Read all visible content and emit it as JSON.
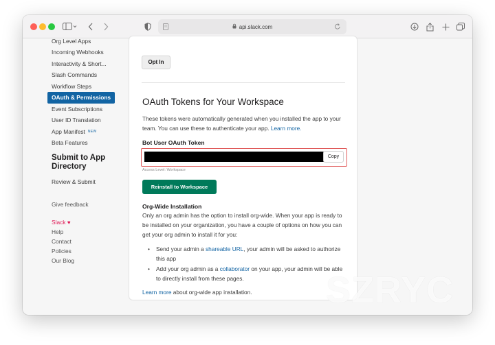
{
  "browser": {
    "url": "api.slack.com"
  },
  "sidebar": {
    "items": [
      {
        "label": "Org Level Apps"
      },
      {
        "label": "Incoming Webhooks"
      },
      {
        "label": "Interactivity & Short..."
      },
      {
        "label": "Slash Commands"
      },
      {
        "label": "Workflow Steps"
      },
      {
        "label": "OAuth & Permissions",
        "active": true
      },
      {
        "label": "Event Subscriptions"
      },
      {
        "label": "User ID Translation"
      },
      {
        "label": "App Manifest",
        "badge": "NEW"
      },
      {
        "label": "Beta Features"
      }
    ],
    "heading": "Submit to App Directory",
    "review": "Review & Submit",
    "feedback": "Give feedback",
    "footer": {
      "slack": "Slack",
      "heart": "♥",
      "help": "Help",
      "contact": "Contact",
      "policies": "Policies",
      "blog": "Our Blog"
    }
  },
  "main": {
    "optin_label": "Opt In",
    "title": "OAuth Tokens for Your Workspace",
    "desc": "These tokens were automatically generated when you installed the app to your team. You can use these to authenticate your app.",
    "desc_link": "Learn more.",
    "token_label": "Bot User OAuth Token",
    "copy_label": "Copy",
    "access_level": "Access Level: Workspace",
    "reinstall_label": "Reinstall to Workspace",
    "org_heading": "Org-Wide Installation",
    "org_desc": "Only an org admin has the option to install org-wide. When your app is ready to be installed on your organization, you have a couple of options on how you can get your org admin to install it for you:",
    "bullet1": {
      "pre": "Send your admin a ",
      "link": "shareable URL",
      "post": ", your admin will be asked to authorize this app"
    },
    "bullet2": {
      "pre": "Add your org admin as a ",
      "link": "collaborator",
      "post": " on your app, your admin will be able to directly install from these pages."
    },
    "learn_link": "Learn more",
    "learn_post": " about org-wide app installation."
  },
  "watermark": "SZRYC",
  "colors": {
    "active": "#1264a3",
    "reinstall": "#007a5a",
    "highlight": "#e05a5a",
    "link": "#1264a3"
  }
}
